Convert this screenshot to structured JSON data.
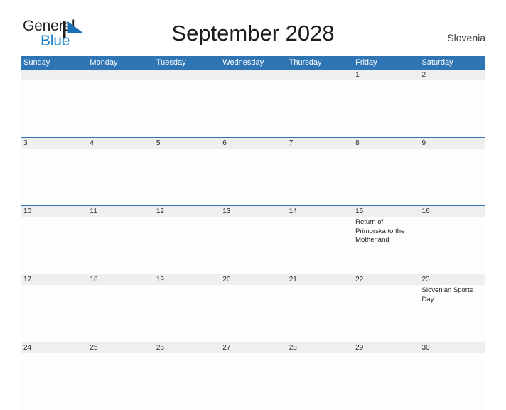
{
  "brand": {
    "name_part1": "General",
    "name_part2": "Blue",
    "flag_icon": "blue-flag-triangle",
    "color_dark": "#231f20",
    "color_blue": "#1b84c8"
  },
  "header": {
    "title": "September 2028",
    "country": "Slovenia"
  },
  "calendar": {
    "accent_color": "#2f74b3",
    "date_band_color": "#efefef",
    "weekdays": [
      "Sunday",
      "Monday",
      "Tuesday",
      "Wednesday",
      "Thursday",
      "Friday",
      "Saturday"
    ],
    "weeks": [
      [
        {
          "date": "",
          "event": ""
        },
        {
          "date": "",
          "event": ""
        },
        {
          "date": "",
          "event": ""
        },
        {
          "date": "",
          "event": ""
        },
        {
          "date": "",
          "event": ""
        },
        {
          "date": "1",
          "event": ""
        },
        {
          "date": "2",
          "event": ""
        }
      ],
      [
        {
          "date": "3",
          "event": ""
        },
        {
          "date": "4",
          "event": ""
        },
        {
          "date": "5",
          "event": ""
        },
        {
          "date": "6",
          "event": ""
        },
        {
          "date": "7",
          "event": ""
        },
        {
          "date": "8",
          "event": ""
        },
        {
          "date": "9",
          "event": ""
        }
      ],
      [
        {
          "date": "10",
          "event": ""
        },
        {
          "date": "11",
          "event": ""
        },
        {
          "date": "12",
          "event": ""
        },
        {
          "date": "13",
          "event": ""
        },
        {
          "date": "14",
          "event": ""
        },
        {
          "date": "15",
          "event": "Return of Primorska to the Motherland"
        },
        {
          "date": "16",
          "event": ""
        }
      ],
      [
        {
          "date": "17",
          "event": ""
        },
        {
          "date": "18",
          "event": ""
        },
        {
          "date": "19",
          "event": ""
        },
        {
          "date": "20",
          "event": ""
        },
        {
          "date": "21",
          "event": ""
        },
        {
          "date": "22",
          "event": ""
        },
        {
          "date": "23",
          "event": "Slovenian Sports Day"
        }
      ],
      [
        {
          "date": "24",
          "event": ""
        },
        {
          "date": "25",
          "event": ""
        },
        {
          "date": "26",
          "event": ""
        },
        {
          "date": "27",
          "event": ""
        },
        {
          "date": "28",
          "event": ""
        },
        {
          "date": "29",
          "event": ""
        },
        {
          "date": "30",
          "event": ""
        }
      ]
    ]
  }
}
